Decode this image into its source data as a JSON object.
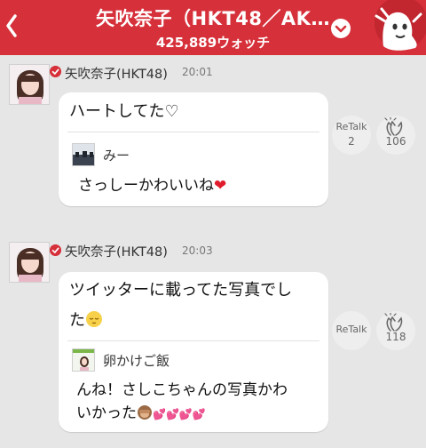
{
  "header": {
    "title": "矢吹奈子（HKT48／AK…",
    "watch_count": "425,889ウォッチ"
  },
  "posts": [
    {
      "author": "矢吹奈子(HKT48)",
      "time": "20:01",
      "message": "ハートしてた♡",
      "quote": {
        "name": "みー",
        "message": "さっしーかわいいね"
      },
      "retalk_label": "ReTalk",
      "retalk_count": "2",
      "clap_count": "106"
    },
    {
      "author": "矢吹奈子(HKT48)",
      "time": "20:03",
      "message_line1": "ツイッターに載ってた写真でし",
      "message_line2": "た",
      "quote": {
        "name": "卵かけご飯",
        "message_line1": "んね！さしこちゃんの写真かわ",
        "message_line2": "いかった"
      },
      "retalk_label": "ReTalk",
      "retalk_count": "",
      "clap_count": "118"
    }
  ],
  "icons": {
    "back": "chevron-left-icon",
    "dropdown": "chevron-down-icon",
    "mascot": "ghost-mascot-icon",
    "verified": "check-badge-icon",
    "clap": "clap-hands-icon",
    "heart": "red-heart-icon",
    "sleepy": "sleepy-face-icon",
    "monkey": "see-no-evil-monkey-icon"
  },
  "colors": {
    "brand": "#d6303a",
    "background": "#e6e6e6",
    "bubble": "#ffffff",
    "heart": "#e01b2c"
  }
}
